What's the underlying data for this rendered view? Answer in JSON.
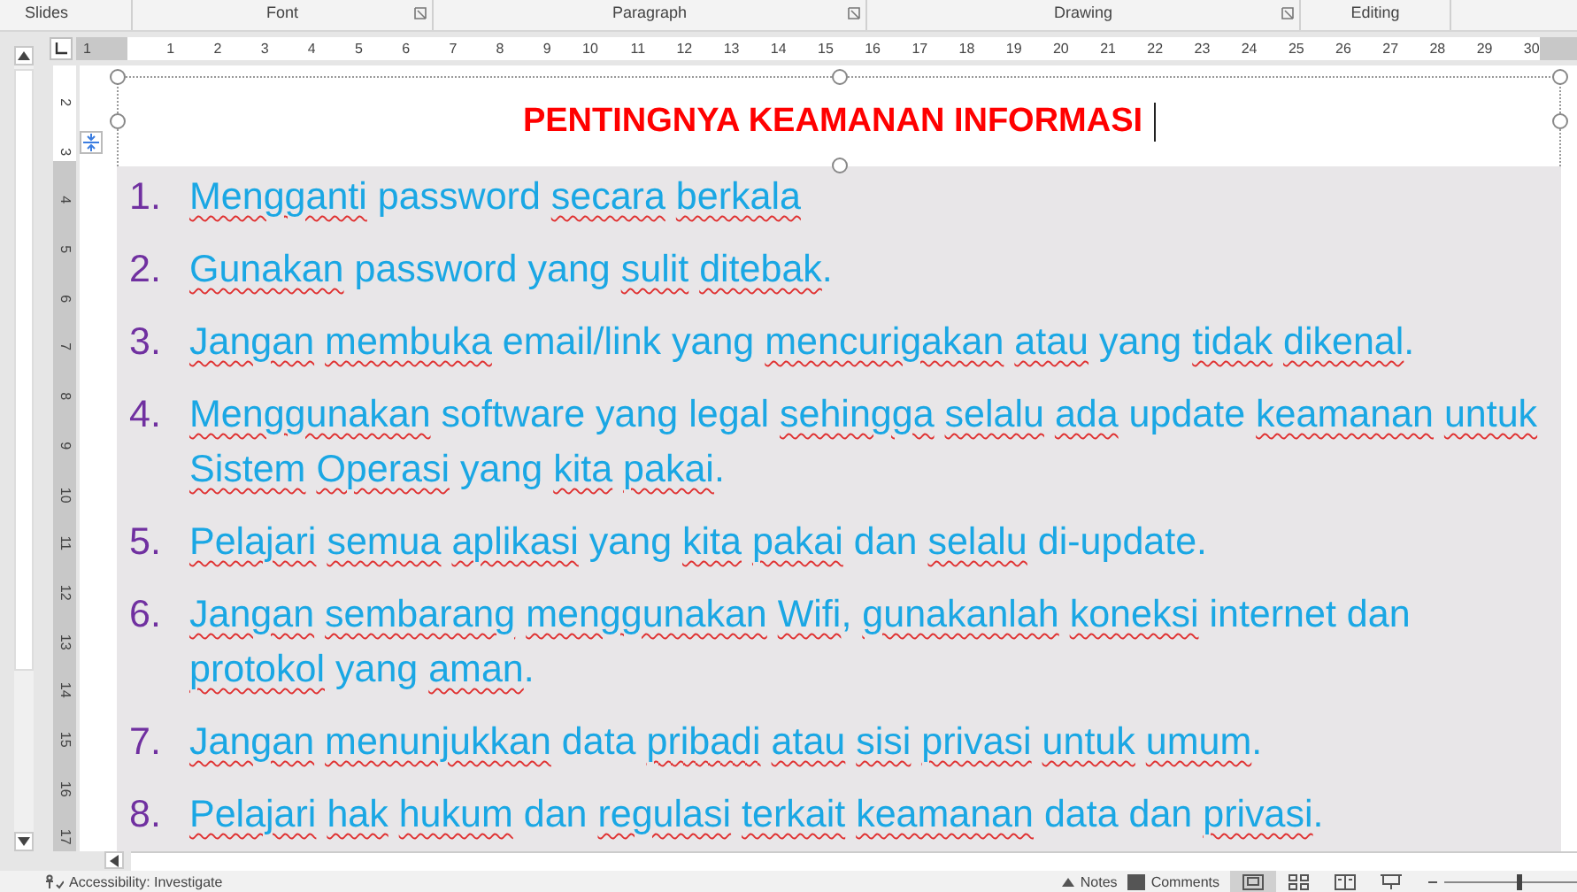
{
  "ribbon_groups": [
    {
      "label": "Slides",
      "launcher": false
    },
    {
      "label": "Font",
      "launcher": true
    },
    {
      "label": "Paragraph",
      "launcher": true
    },
    {
      "label": "Drawing",
      "launcher": true
    },
    {
      "label": "Editing",
      "launcher": false
    }
  ],
  "ruler": {
    "marks": [
      "1",
      "1",
      "2",
      "3",
      "4",
      "5",
      "6",
      "7",
      "8",
      "9",
      "10",
      "11",
      "12",
      "13",
      "14",
      "15",
      "16",
      "17",
      "18",
      "19",
      "20",
      "21",
      "22",
      "23",
      "24",
      "25",
      "26",
      "27",
      "28",
      "29",
      "30"
    ],
    "vertical_marks": [
      "2",
      "3",
      "4",
      "5",
      "6",
      "7",
      "8",
      "9",
      "10",
      "11",
      "12",
      "13",
      "14",
      "15",
      "16",
      "17"
    ]
  },
  "slide": {
    "title": "PENTINGNYA KEAMANAN INFORMASI",
    "items": [
      {
        "number": "1.",
        "words": [
          {
            "t": "Mengganti",
            "err": true
          },
          {
            "t": "password",
            "err": false
          },
          {
            "t": "secara",
            "err": true
          },
          {
            "t": "berkala",
            "err": true
          }
        ]
      },
      {
        "number": "2.",
        "words": [
          {
            "t": "Gunakan",
            "err": true
          },
          {
            "t": "password yang",
            "err": false
          },
          {
            "t": "sulit",
            "err": true
          },
          {
            "t": "ditebak",
            "err": true,
            "after": "."
          }
        ]
      },
      {
        "number": "3.",
        "words": [
          {
            "t": "Jangan",
            "err": true
          },
          {
            "t": "membuka",
            "err": true
          },
          {
            "t": "email/link yang",
            "err": false
          },
          {
            "t": "mencurigakan",
            "err": true
          },
          {
            "t": "atau",
            "err": true
          },
          {
            "t": "yang",
            "err": false
          },
          {
            "t": "tidak",
            "err": true
          },
          {
            "t": "dikenal",
            "err": true,
            "after": "."
          }
        ]
      },
      {
        "number": "4.",
        "words": [
          {
            "t": "Menggunakan",
            "err": true
          },
          {
            "t": "software yang legal",
            "err": false
          },
          {
            "t": "sehingga",
            "err": true
          },
          {
            "t": "selalu",
            "err": true
          },
          {
            "t": "ada",
            "err": true
          },
          {
            "t": "update",
            "err": false
          },
          {
            "t": "keamanan",
            "err": true
          },
          {
            "t": "untuk",
            "err": true
          },
          {
            "t": "Sistem",
            "err": true
          },
          {
            "t": "Operasi",
            "err": true
          },
          {
            "t": "yang",
            "err": false
          },
          {
            "t": "kita",
            "err": true
          },
          {
            "t": "pakai",
            "err": true,
            "after": "."
          }
        ]
      },
      {
        "number": "5.",
        "words": [
          {
            "t": "Pelajari",
            "err": true
          },
          {
            "t": "semua",
            "err": true
          },
          {
            "t": "aplikasi",
            "err": true
          },
          {
            "t": "yang",
            "err": false
          },
          {
            "t": "kita",
            "err": true
          },
          {
            "t": "pakai",
            "err": true
          },
          {
            "t": "dan",
            "err": false
          },
          {
            "t": "selalu",
            "err": true
          },
          {
            "t": "di-update.",
            "err": false
          }
        ]
      },
      {
        "number": "6.",
        "words": [
          {
            "t": "Jangan",
            "err": true
          },
          {
            "t": "sembarang",
            "err": true
          },
          {
            "t": "menggunakan",
            "err": true
          },
          {
            "t": "Wifi",
            "err": true,
            "after": ","
          },
          {
            "t": "gunakanlah",
            "err": true
          },
          {
            "t": "koneksi",
            "err": true
          },
          {
            "t": "internet dan",
            "err": false
          },
          {
            "t": "protokol",
            "err": true
          },
          {
            "t": "yang",
            "err": false
          },
          {
            "t": "aman",
            "err": true,
            "after": "."
          }
        ]
      },
      {
        "number": "7.",
        "words": [
          {
            "t": "Jangan",
            "err": true
          },
          {
            "t": "menunjukkan",
            "err": true
          },
          {
            "t": "data",
            "err": false
          },
          {
            "t": "pribadi",
            "err": true
          },
          {
            "t": "atau",
            "err": true
          },
          {
            "t": "sisi",
            "err": true
          },
          {
            "t": "privasi",
            "err": true
          },
          {
            "t": "untuk",
            "err": true
          },
          {
            "t": "umum",
            "err": true,
            "after": "."
          }
        ]
      },
      {
        "number": "8.",
        "words": [
          {
            "t": "Pelajari",
            "err": true
          },
          {
            "t": "hak",
            "err": true
          },
          {
            "t": "hukum",
            "err": true
          },
          {
            "t": "dan",
            "err": false
          },
          {
            "t": "regulasi",
            "err": true
          },
          {
            "t": "terkait",
            "err": true
          },
          {
            "t": "keamanan",
            "err": true
          },
          {
            "t": "data dan",
            "err": false
          },
          {
            "t": "privasi",
            "err": true,
            "after": "."
          }
        ]
      }
    ]
  },
  "status_bar": {
    "accessibility": "Accessibility: Investigate",
    "notes": "Notes",
    "comments": "Comments",
    "views": [
      {
        "kind": "normal",
        "selected": true
      },
      {
        "kind": "sorter",
        "selected": false
      },
      {
        "kind": "reading",
        "selected": false
      },
      {
        "kind": "slideshow",
        "selected": false
      }
    ],
    "zoom": {
      "level": 0.55
    }
  }
}
